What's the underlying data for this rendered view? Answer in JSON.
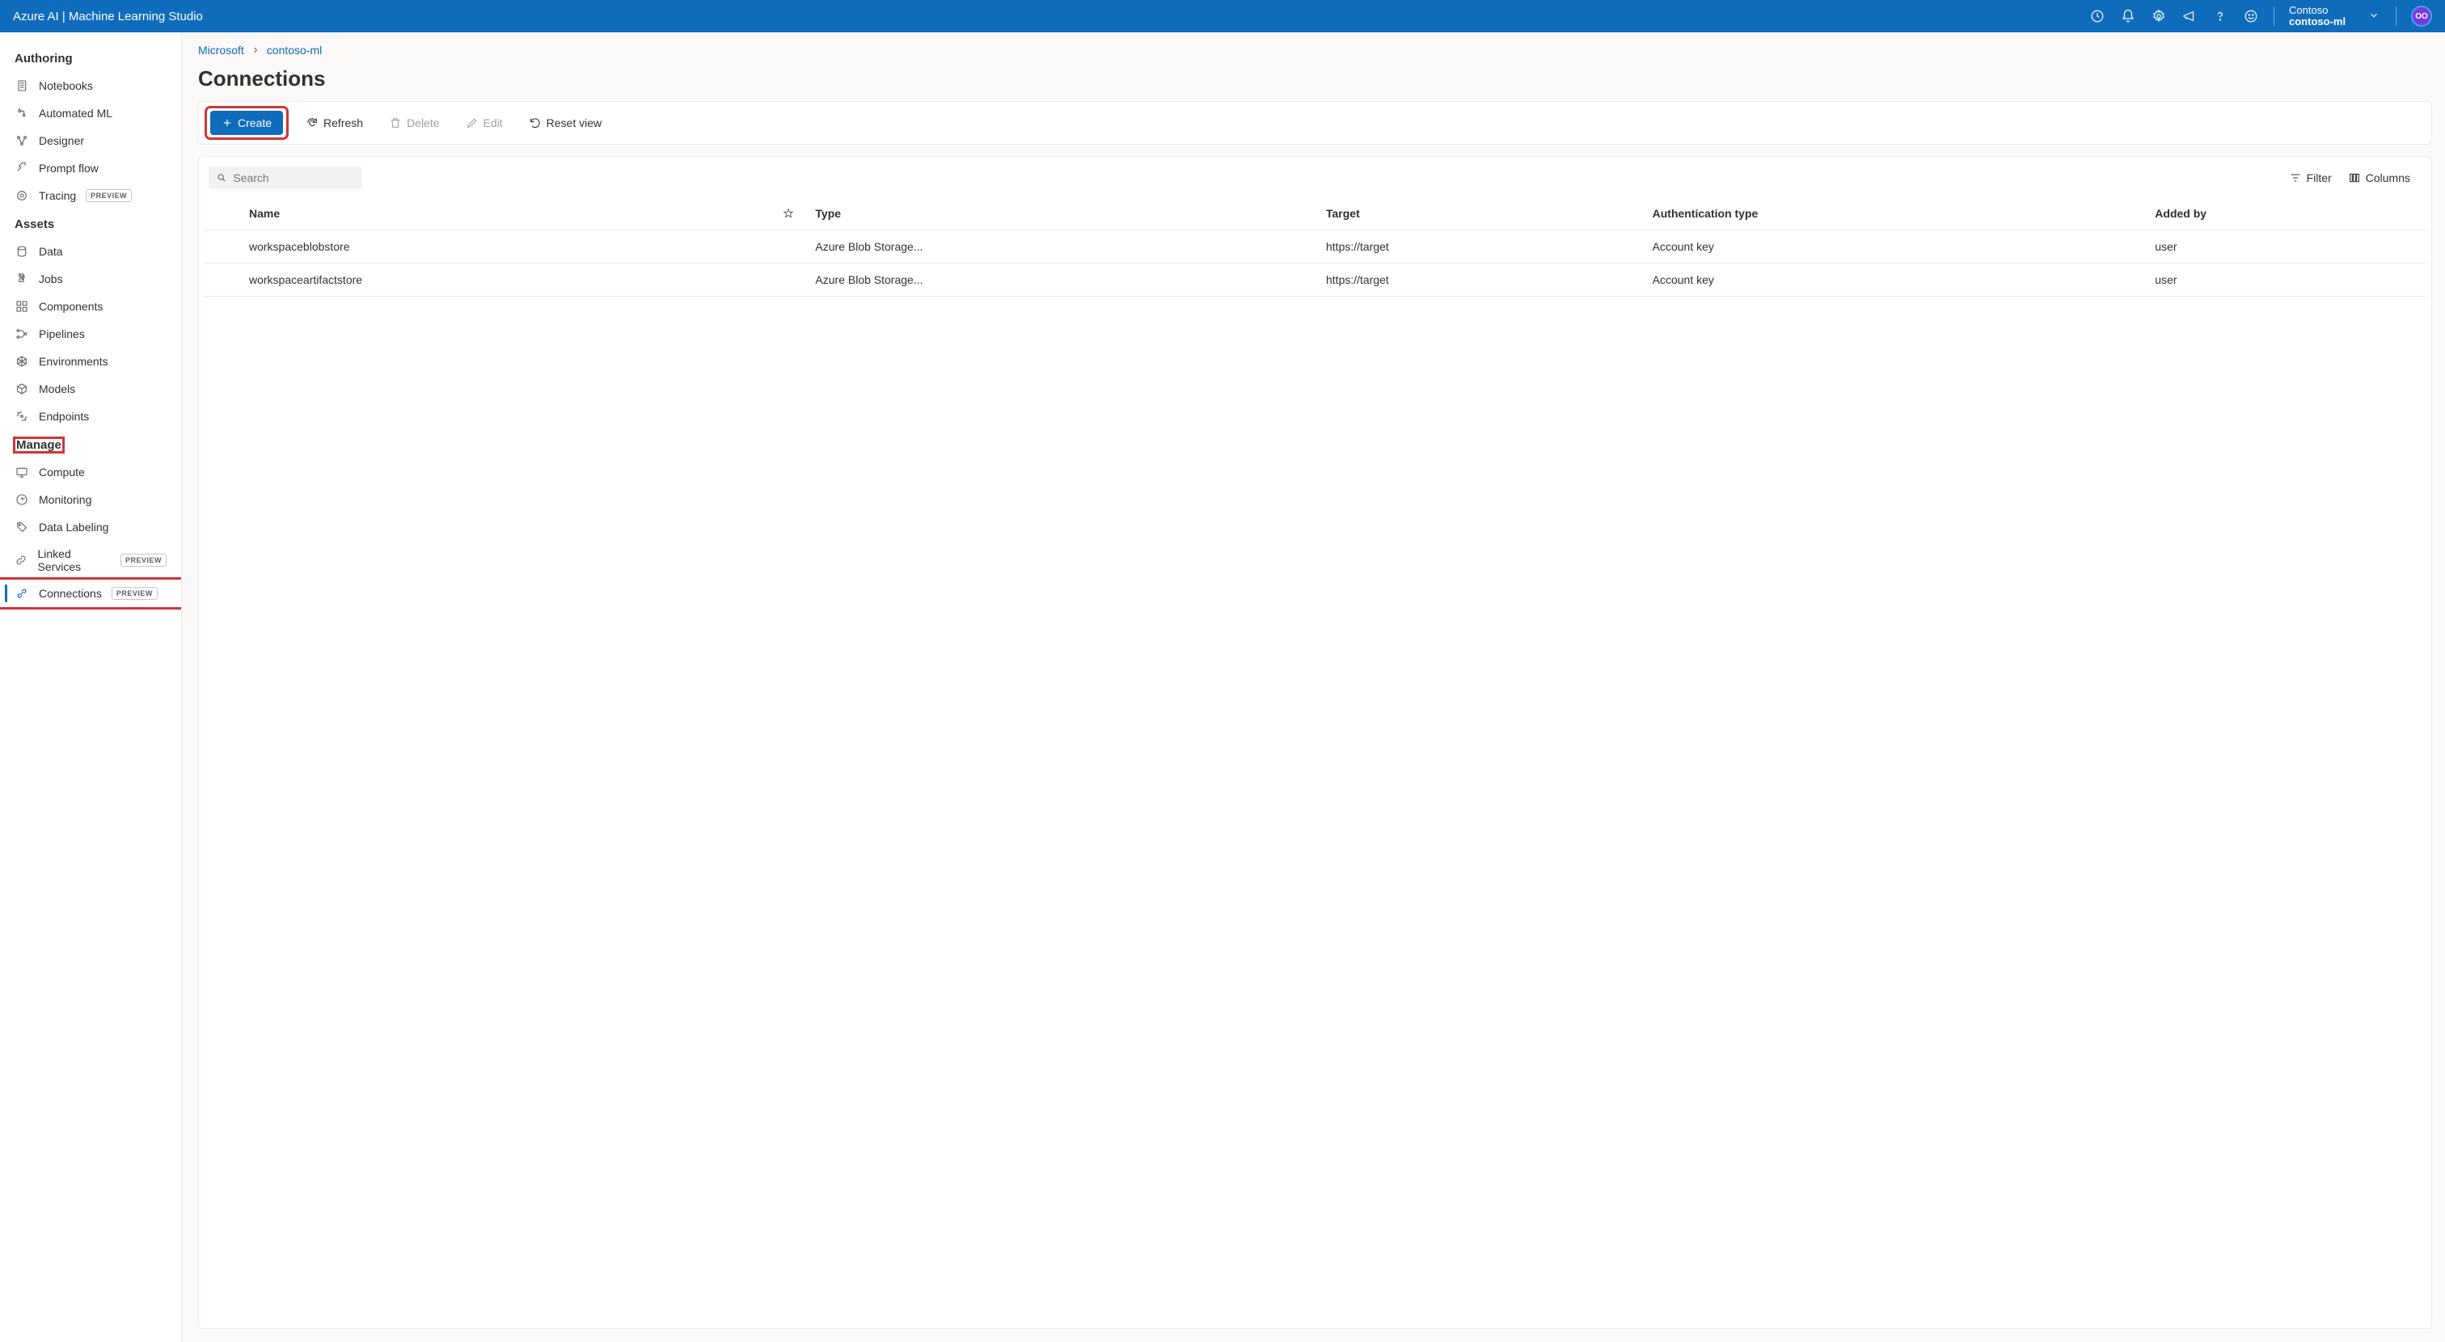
{
  "header": {
    "title": "Azure AI | Machine Learning Studio",
    "org_name": "Contoso",
    "workspace_name": "contoso-ml",
    "avatar_initials": "OO"
  },
  "sidebar": {
    "sections": [
      {
        "label": "Authoring",
        "items": [
          {
            "label": "Notebooks",
            "icon": "notebook"
          },
          {
            "label": "Automated ML",
            "icon": "automl"
          },
          {
            "label": "Designer",
            "icon": "designer"
          },
          {
            "label": "Prompt flow",
            "icon": "promptflow"
          },
          {
            "label": "Tracing",
            "icon": "tracing",
            "preview": true
          }
        ]
      },
      {
        "label": "Assets",
        "items": [
          {
            "label": "Data",
            "icon": "data"
          },
          {
            "label": "Jobs",
            "icon": "jobs"
          },
          {
            "label": "Components",
            "icon": "components"
          },
          {
            "label": "Pipelines",
            "icon": "pipelines"
          },
          {
            "label": "Environments",
            "icon": "environments"
          },
          {
            "label": "Models",
            "icon": "models"
          },
          {
            "label": "Endpoints",
            "icon": "endpoints"
          }
        ]
      },
      {
        "label": "Manage",
        "highlight": true,
        "items": [
          {
            "label": "Compute",
            "icon": "compute"
          },
          {
            "label": "Monitoring",
            "icon": "monitoring"
          },
          {
            "label": "Data Labeling",
            "icon": "labeling"
          },
          {
            "label": "Linked Services",
            "icon": "linked",
            "preview": true
          },
          {
            "label": "Connections",
            "icon": "connections",
            "preview": true,
            "active": true,
            "highlight_row": true
          }
        ]
      }
    ],
    "preview_badge_text": "PREVIEW"
  },
  "breadcrumb": {
    "items": [
      {
        "label": "Microsoft"
      },
      {
        "label": "contoso-ml"
      }
    ]
  },
  "page": {
    "title": "Connections"
  },
  "toolbar": {
    "create_label": "Create",
    "refresh_label": "Refresh",
    "delete_label": "Delete",
    "edit_label": "Edit",
    "reset_label": "Reset view"
  },
  "table_controls": {
    "search_placeholder": "Search",
    "filter_label": "Filter",
    "columns_label": "Columns"
  },
  "table": {
    "columns": [
      "Name",
      "Type",
      "Target",
      "Authentication type",
      "Added by"
    ],
    "rows": [
      {
        "name": "workspaceblobstore",
        "type": "Azure Blob Storage...",
        "target": "https://target",
        "auth": "Account key",
        "added_by": "user"
      },
      {
        "name": "workspaceartifactstore",
        "type": "Azure Blob Storage...",
        "target": "https://target",
        "auth": "Account key",
        "added_by": "user"
      }
    ]
  }
}
